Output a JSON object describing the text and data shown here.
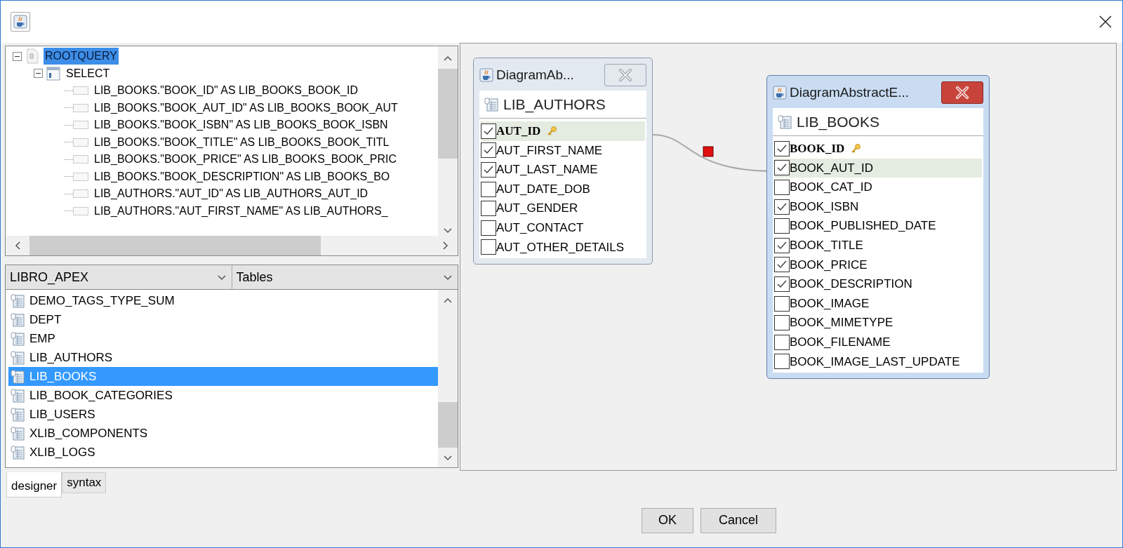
{
  "tree": [
    {
      "label": "ROOTQUERY",
      "kind": "query",
      "selected": true,
      "expanded": true,
      "children": [
        {
          "label": "SELECT",
          "kind": "select",
          "selected": false,
          "expanded": true,
          "children": [
            {
              "label": "LIB_BOOKS.\"BOOK_ID\" AS LIB_BOOKS_BOOK_ID",
              "kind": "column",
              "selected": false
            },
            {
              "label": "LIB_BOOKS.\"BOOK_AUT_ID\" AS LIB_BOOKS_BOOK_AUT",
              "kind": "column",
              "selected": false
            },
            {
              "label": "LIB_BOOKS.\"BOOK_ISBN\" AS LIB_BOOKS_BOOK_ISBN",
              "kind": "column",
              "selected": false
            },
            {
              "label": "LIB_BOOKS.\"BOOK_TITLE\" AS LIB_BOOKS_BOOK_TITL",
              "kind": "column",
              "selected": false
            },
            {
              "label": "LIB_BOOKS.\"BOOK_PRICE\" AS LIB_BOOKS_BOOK_PRIC",
              "kind": "column",
              "selected": false
            },
            {
              "label": "LIB_BOOKS.\"BOOK_DESCRIPTION\" AS LIB_BOOKS_BO",
              "kind": "column",
              "selected": false
            },
            {
              "label": "LIB_AUTHORS.\"AUT_ID\" AS LIB_AUTHORS_AUT_ID",
              "kind": "column",
              "selected": false
            },
            {
              "label": "LIB_AUTHORS.\"AUT_FIRST_NAME\" AS LIB_AUTHORS_",
              "kind": "column",
              "selected": false
            }
          ]
        }
      ]
    }
  ],
  "schema_select": {
    "value": "LIBRO_APEX"
  },
  "type_select": {
    "value": "Tables"
  },
  "tables": [
    {
      "name": "DEMO_TAGS_TYPE_SUM",
      "selected": false
    },
    {
      "name": "DEPT",
      "selected": false
    },
    {
      "name": "EMP",
      "selected": false
    },
    {
      "name": "LIB_AUTHORS",
      "selected": false
    },
    {
      "name": "LIB_BOOKS",
      "selected": true
    },
    {
      "name": "LIB_BOOK_CATEGORIES",
      "selected": false
    },
    {
      "name": "LIB_USERS",
      "selected": false
    },
    {
      "name": "XLIB_COMPONENTS",
      "selected": false
    },
    {
      "name": "XLIB_LOGS",
      "selected": false
    }
  ],
  "tabs": [
    {
      "label": "designer",
      "selected": true
    },
    {
      "label": "syntax",
      "selected": false
    }
  ],
  "diagram": {
    "windows": [
      {
        "title": "DiagramAb...",
        "active": false,
        "table": "LIB_AUTHORS",
        "columns": [
          {
            "name": "AUT_ID",
            "checked": true,
            "primary_key": true,
            "highlighted": true
          },
          {
            "name": "AUT_FIRST_NAME",
            "checked": true,
            "primary_key": false,
            "highlighted": false
          },
          {
            "name": "AUT_LAST_NAME",
            "checked": true,
            "primary_key": false,
            "highlighted": false
          },
          {
            "name": "AUT_DATE_DOB",
            "checked": false,
            "primary_key": false,
            "highlighted": false
          },
          {
            "name": "AUT_GENDER",
            "checked": false,
            "primary_key": false,
            "highlighted": false
          },
          {
            "name": "AUT_CONTACT",
            "checked": false,
            "primary_key": false,
            "highlighted": false
          },
          {
            "name": "AUT_OTHER_DETAILS",
            "checked": false,
            "primary_key": false,
            "highlighted": false
          }
        ]
      },
      {
        "title": "DiagramAbstractE...",
        "active": true,
        "table": "LIB_BOOKS",
        "columns": [
          {
            "name": "BOOK_ID",
            "checked": true,
            "primary_key": true,
            "highlighted": false
          },
          {
            "name": "BOOK_AUT_ID",
            "checked": true,
            "primary_key": false,
            "highlighted": true
          },
          {
            "name": "BOOK_CAT_ID",
            "checked": false,
            "primary_key": false,
            "highlighted": false
          },
          {
            "name": "BOOK_ISBN",
            "checked": true,
            "primary_key": false,
            "highlighted": false
          },
          {
            "name": "BOOK_PUBLISHED_DATE",
            "checked": false,
            "primary_key": false,
            "highlighted": false
          },
          {
            "name": "BOOK_TITLE",
            "checked": true,
            "primary_key": false,
            "highlighted": false
          },
          {
            "name": "BOOK_PRICE",
            "checked": true,
            "primary_key": false,
            "highlighted": false
          },
          {
            "name": "BOOK_DESCRIPTION",
            "checked": true,
            "primary_key": false,
            "highlighted": false
          },
          {
            "name": "BOOK_IMAGE",
            "checked": false,
            "primary_key": false,
            "highlighted": false
          },
          {
            "name": "BOOK_MIMETYPE",
            "checked": false,
            "primary_key": false,
            "highlighted": false
          },
          {
            "name": "BOOK_FILENAME",
            "checked": false,
            "primary_key": false,
            "highlighted": false
          },
          {
            "name": "BOOK_IMAGE_LAST_UPDATE",
            "checked": false,
            "primary_key": false,
            "highlighted": false
          }
        ]
      }
    ]
  },
  "buttons": [
    "OK",
    "Cancel"
  ]
}
